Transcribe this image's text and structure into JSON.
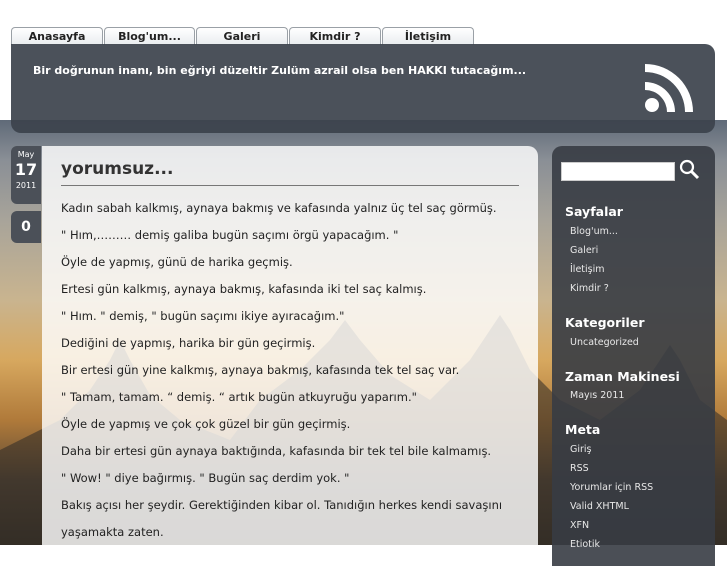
{
  "nav": {
    "tabs": [
      "Anasayfa",
      "Blog'um...",
      "Galeri",
      "Kimdir ?",
      "İletişim"
    ]
  },
  "header": {
    "tagline": "Bir doğrunun inanı, bin eğriyi düzeltir Zulüm azrail olsa ben HAKKI tutacağım..."
  },
  "post": {
    "month": "May",
    "day": "17",
    "year": "2011",
    "comment_count": "0",
    "title": "yorumsuz...",
    "paragraphs": [
      "Kadın sabah kalkmış, aynaya bakmış ve kafasında yalnız üç tel saç görmüş.",
      "\" Hım,……… demiş galiba bugün saçımı örgü yapacağım. \"",
      "Öyle de yapmış, günü de harika geçmiş.",
      "Ertesi gün kalkmış, aynaya bakmış, kafasında iki tel saç kalmış.",
      "\" Hım. \" demiş, \" bugün saçımı ikiye ayıracağım.\"",
      "Dediğini de yapmış, harika bir gün geçirmiş.",
      "Bir ertesi gün yine kalkmış, aynaya bakmış, kafasında tek tel saç var.",
      "\" Tamam, tamam. “ demiş. “ artık bugün atkuyruğu yaparım.\"",
      "Öyle de yapmış ve çok çok güzel bir gün geçirmiş.",
      "Daha bir ertesi gün aynaya baktığında, kafasında bir tek tel bile kalmamış.",
      "\" Wow! \" diye bağırmış. \" Bugün saç derdim yok. \"",
      "Bakış açısı her şeydir. Gerektiğinden kibar ol. Tanıdığın herkes kendi savaşını",
      "yaşamakta zaten."
    ]
  },
  "sidebar": {
    "pages_title": "Sayfalar",
    "pages": [
      "Blog'um...",
      "Galeri",
      "İletişim",
      "Kimdir ?"
    ],
    "categories_title": "Kategoriler",
    "categories": [
      "Uncategorized"
    ],
    "archive_title": "Zaman Makinesi",
    "archive": [
      "Mayıs 2011"
    ],
    "meta_title": "Meta",
    "meta": [
      "Giriş",
      "RSS",
      "Yorumlar için RSS",
      "Valid XHTML",
      "XFN",
      "Etiotik"
    ]
  }
}
